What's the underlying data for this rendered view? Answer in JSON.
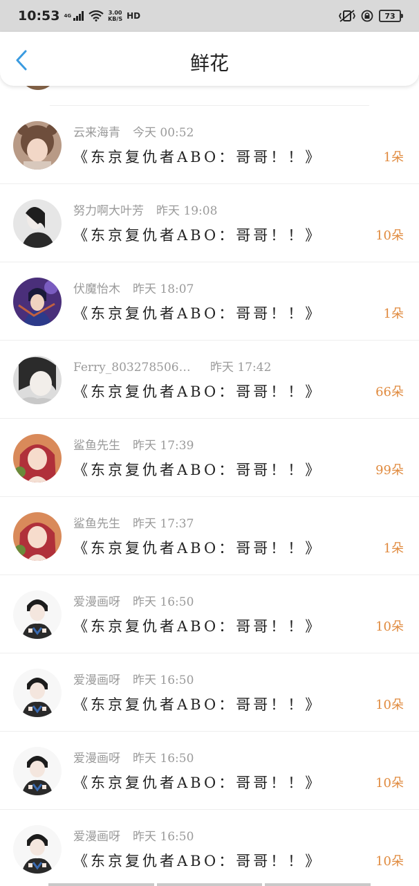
{
  "status_bar": {
    "time": "10:53",
    "network_type": "4G",
    "speed_value": "3.00",
    "speed_unit": "KB/S",
    "hd_label": "HD",
    "battery_level": "73"
  },
  "header": {
    "title": "鲜花"
  },
  "colors": {
    "accent": "#3a9be0",
    "count": "#e08a3e",
    "meta": "#9a9a9a"
  },
  "rows": [
    {
      "user": "云来海青",
      "time": "今天 00:52",
      "work": "《东京复仇者ABO：哥哥！！》",
      "count": "1朵",
      "avatar": "child-bear-hat"
    },
    {
      "user": "努力啊大叶芳",
      "time": "昨天 19:08",
      "work": "《东京复仇者ABO：哥哥！！》",
      "count": "10朵",
      "avatar": "woman-bw"
    },
    {
      "user": "伏魔怡木",
      "time": "昨天 18:07",
      "work": "《东京复仇者ABO：哥哥！！》",
      "count": "1朵",
      "avatar": "anime-purple"
    },
    {
      "user": "Ferry_8032785063 ...",
      "time": "昨天 17:42",
      "work": "《东京复仇者ABO：哥哥！！》",
      "count": "66朵",
      "avatar": "girl-bw"
    },
    {
      "user": "鲨鱼先生",
      "time": "昨天 17:39",
      "work": "《东京复仇者ABO：哥哥！！》",
      "count": "99朵",
      "avatar": "anime-redhair"
    },
    {
      "user": "鲨鱼先生",
      "time": "昨天 17:37",
      "work": "《东京复仇者ABO：哥哥！！》",
      "count": "1朵",
      "avatar": "anime-redhair"
    },
    {
      "user": "爱漫画呀",
      "time": "昨天 16:50",
      "work": "《东京复仇者ABO：哥哥！！》",
      "count": "10朵",
      "avatar": "anime-boy-heart"
    },
    {
      "user": "爱漫画呀",
      "time": "昨天 16:50",
      "work": "《东京复仇者ABO：哥哥！！》",
      "count": "10朵",
      "avatar": "anime-boy-heart"
    },
    {
      "user": "爱漫画呀",
      "time": "昨天 16:50",
      "work": "《东京复仇者ABO：哥哥！！》",
      "count": "10朵",
      "avatar": "anime-boy-heart"
    },
    {
      "user": "爱漫画呀",
      "time": "昨天 16:50",
      "work": "《东京复仇者ABO：哥哥！！》",
      "count": "10朵",
      "avatar": "anime-boy-heart"
    }
  ]
}
